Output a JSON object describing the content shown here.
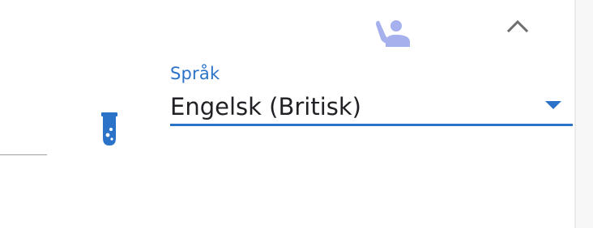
{
  "language_select": {
    "label": "Språk",
    "value": "Engelsk (Britisk)"
  },
  "icons": {
    "person": "person-raised-hand-icon",
    "chevron": "chevron-up-icon",
    "flask": "test-tube-icon",
    "dropdown": "dropdown-arrow-icon"
  },
  "colors": {
    "accent": "#2b73c9",
    "person_icon": "#a6b0ec",
    "chevron": "#6e6e6e",
    "text": "#202124"
  }
}
